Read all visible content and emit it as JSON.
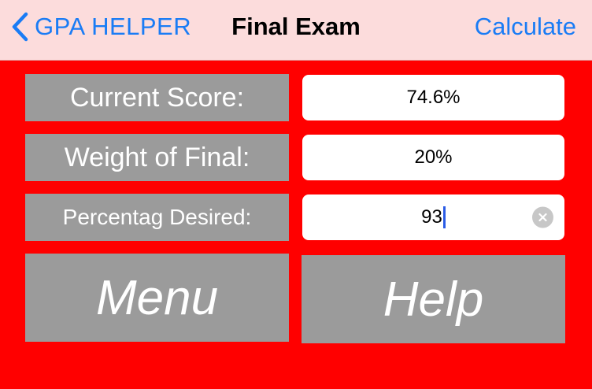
{
  "navbar": {
    "back_label": "GPA HELPER",
    "title": "Final Exam",
    "action_label": "Calculate"
  },
  "form": {
    "rows": [
      {
        "label": "Current Score:",
        "value": "74.6%"
      },
      {
        "label": "Weight of Final:",
        "value": "20%"
      },
      {
        "label": "Percentag Desired:",
        "value": "93"
      }
    ]
  },
  "buttons": {
    "menu": "Menu",
    "help": "Help"
  },
  "colors": {
    "background": "#ff0000",
    "navbar": "#fcdcdc",
    "accent": "#1a7cf5",
    "panel": "#9b9b9b"
  },
  "icons": {
    "back": "chevron-left-icon",
    "clear": "clear-circle-icon"
  }
}
